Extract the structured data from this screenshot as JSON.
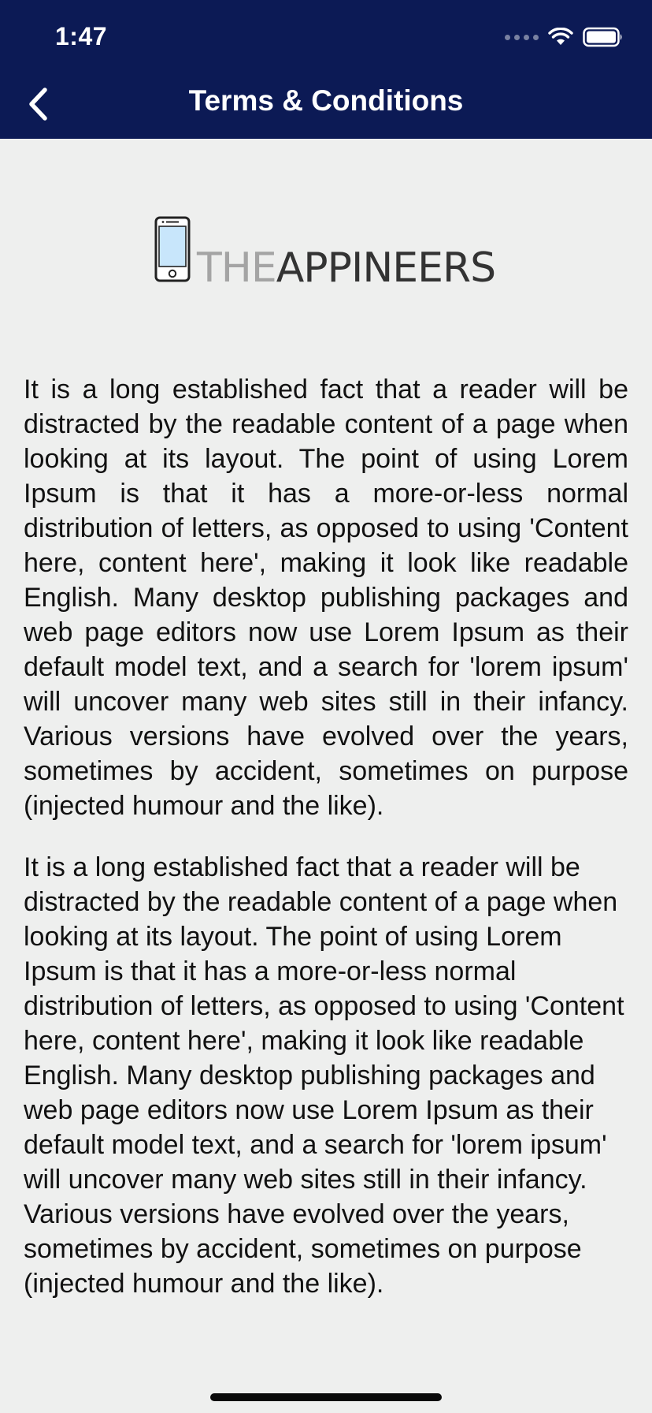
{
  "status_bar": {
    "time": "1:47"
  },
  "nav": {
    "back_icon": "chevron-left-icon",
    "title": "Terms & Conditions"
  },
  "logo": {
    "icon": "smartphone-icon",
    "text_light": "THE",
    "text_dark": "APPINEERS"
  },
  "content": {
    "paragraphs": [
      "It is a long established fact that a reader will be distracted by the readable content of a page when looking at its layout. The point of using Lorem Ipsum is that it has a more-or-less normal distribution of letters, as opposed to using 'Content here, content here', making it look like readable English. Many desktop publishing packages and web page editors now use Lorem Ipsum as their default model text, and a search for 'lorem ipsum' will uncover many web sites still in their infancy. Various versions have evolved over the years, sometimes by accident, sometimes on purpose (injected humour and the like).",
      "It is a long established fact that a reader will be distracted by the readable content of a page when looking at its layout. The point of using Lorem Ipsum is that it has a more-or-less normal distribution of letters, as opposed to using 'Content here, content here', making it look like readable English. Many desktop publishing packages and web page editors now use Lorem Ipsum as their default model text, and a search for 'lorem ipsum' will uncover many web sites still in their infancy. Various versions have evolved over the years, sometimes by accident, sometimes on purpose (injected humour and the like)."
    ]
  },
  "colors": {
    "header_bg": "#0c1a55",
    "page_bg": "#eeefee",
    "text": "#111111"
  }
}
